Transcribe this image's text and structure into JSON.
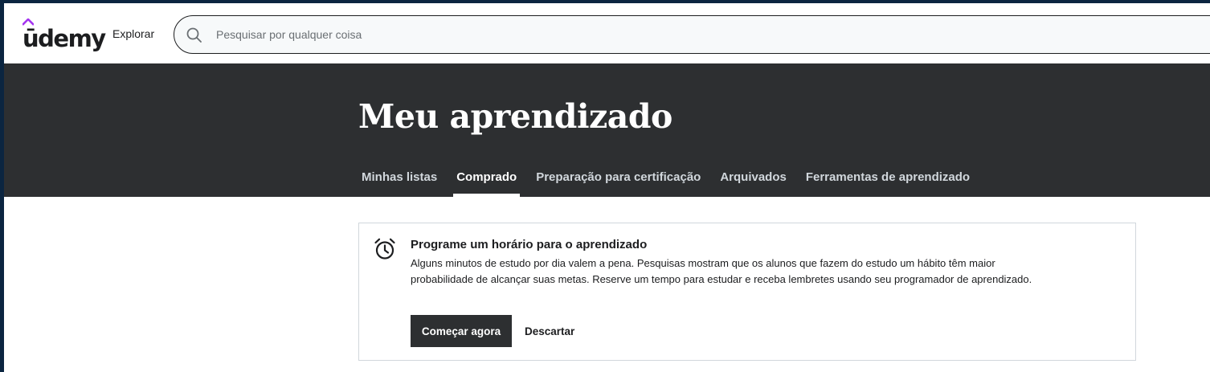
{
  "header": {
    "logo_text": "ūdemy",
    "logo_accent_color": "#a435f0",
    "explore_label": "Explorar",
    "search": {
      "placeholder": "Pesquisar por qualquer coisa",
      "value": "",
      "icon": "search-icon"
    }
  },
  "banner": {
    "title": "Meu aprendizado",
    "background_color": "#2d2f31",
    "tabs": [
      {
        "label": "Minhas listas",
        "active": false
      },
      {
        "label": "Comprado",
        "active": true
      },
      {
        "label": "Preparação para certificação",
        "active": false
      },
      {
        "label": "Arquivados",
        "active": false
      },
      {
        "label": "Ferramentas de aprendizado",
        "active": false
      }
    ]
  },
  "schedule_card": {
    "icon": "alarm-clock-icon",
    "title": "Programe um horário para o aprendizado",
    "body": "Alguns minutos de estudo por dia valem a pena. Pesquisas mostram que os alunos que fazem do estudo um hábito têm maior probabilidade de alcançar suas metas. Reserve um tempo para estudar e receba lembretes usando seu programador de aprendizado.",
    "start_label": "Começar agora",
    "dismiss_label": "Descartar"
  }
}
